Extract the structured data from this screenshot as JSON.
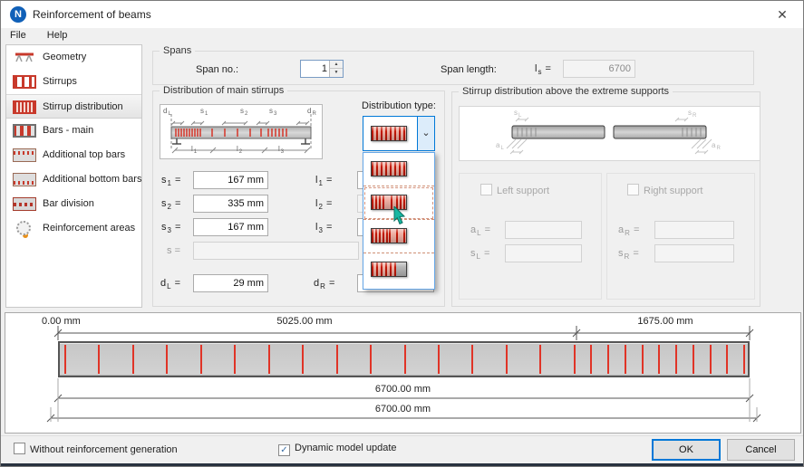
{
  "window": {
    "title": "Reinforcement of beams",
    "close_glyph": "✕",
    "app_icon_letter": "N"
  },
  "menu": {
    "items": [
      {
        "label": "File"
      },
      {
        "label": "Help"
      }
    ]
  },
  "sidebar": {
    "selected_index": 2,
    "items": [
      {
        "label": "Geometry",
        "icon": "geometry-icon"
      },
      {
        "label": "Stirrups",
        "icon": "stirrups-icon"
      },
      {
        "label": "Stirrup distribution",
        "icon": "stirrup-distribution-icon"
      },
      {
        "label": "Bars - main",
        "icon": "bars-main-icon"
      },
      {
        "label": "Additional top bars",
        "icon": "additional-top-bars-icon"
      },
      {
        "label": "Additional bottom bars",
        "icon": "additional-bottom-bars-icon"
      },
      {
        "label": "Bar division",
        "icon": "bar-division-icon"
      },
      {
        "label": "Reinforcement areas",
        "icon": "reinforcement-areas-icon"
      }
    ]
  },
  "spans": {
    "group_label": "Spans",
    "span_no_label": "Span no.:",
    "span_no_value": "1",
    "span_length_label": "Span length:",
    "length_symbol": {
      "sym": "l",
      "sub": "s",
      "eq": "="
    },
    "span_length_value": "6700"
  },
  "main_stirrups": {
    "group_label": "Distribution of main stirrups",
    "diagram_top_labels": [
      {
        "sym": "d",
        "sub": "L"
      },
      {
        "sym": "s",
        "sub": "1"
      },
      {
        "sym": "s",
        "sub": "2"
      },
      {
        "sym": "s",
        "sub": "3"
      },
      {
        "sym": "d",
        "sub": "R"
      }
    ],
    "diagram_bottom_labels": [
      {
        "sym": "l",
        "sub": "1"
      },
      {
        "sym": "l",
        "sub": "2"
      },
      {
        "sym": "l",
        "sub": "3"
      }
    ],
    "s_rows": [
      {
        "sym": "s",
        "sub": "1",
        "eq": "=",
        "value": "167 mm"
      },
      {
        "sym": "s",
        "sub": "2",
        "eq": "=",
        "value": "335 mm"
      },
      {
        "sym": "s",
        "sub": "3",
        "eq": "=",
        "value": "167 mm"
      },
      {
        "sym": "s",
        "sub": "",
        "eq": "=",
        "value": ""
      }
    ],
    "l_rows": [
      {
        "sym": "l",
        "sub": "1",
        "eq": "=",
        "value": ""
      },
      {
        "sym": "l",
        "sub": "2",
        "eq": "=",
        "value": ""
      },
      {
        "sym": "l",
        "sub": "3",
        "eq": "=",
        "value": ""
      }
    ],
    "d_left": {
      "sym": "d",
      "sub": "L",
      "eq": "=",
      "value": "29 mm"
    },
    "d_right": {
      "sym": "d",
      "sub": "R",
      "eq": "=",
      "value": ""
    }
  },
  "distribution_type": {
    "label": "Distribution type:",
    "selected_option_icon": "stirrup-pattern-uniform-icon",
    "options": [
      {
        "icon": "stirrup-pattern-uniform-icon"
      },
      {
        "icon": "stirrup-pattern-symmetric-icon"
      },
      {
        "icon": "stirrup-pattern-left-dense-icon"
      },
      {
        "icon": "stirrup-pattern-partial-icon"
      }
    ]
  },
  "supports": {
    "group_label": "Stirrup distribution above the extreme supports",
    "diagram_labels": [
      {
        "sym": "s",
        "sub": "L"
      },
      {
        "sym": "a",
        "sub": "L"
      },
      {
        "sym": "s",
        "sub": "R"
      },
      {
        "sym": "a",
        "sub": "R"
      }
    ],
    "left": {
      "checkbox_label": "Left support",
      "checked": false,
      "rows": [
        {
          "sym": "a",
          "sub": "L",
          "eq": "=",
          "value": ""
        },
        {
          "sym": "s",
          "sub": "L",
          "eq": "=",
          "value": ""
        }
      ]
    },
    "right": {
      "checkbox_label": "Right support",
      "checked": false,
      "rows": [
        {
          "sym": "a",
          "sub": "R",
          "eq": "=",
          "value": ""
        },
        {
          "sym": "s",
          "sub": "R",
          "eq": "=",
          "value": ""
        }
      ]
    }
  },
  "preview": {
    "dim_labels_top": [
      "0.00 mm",
      "5025.00 mm",
      "1675.00 mm"
    ],
    "dim_total_inner": "6700.00 mm",
    "dim_total_outer": "6700.00 mm",
    "total_length_mm": 6700,
    "boundary_mm": 5025,
    "segments": [
      {
        "from_mm": 0,
        "to_mm": 5025,
        "stirrup_count": 16
      },
      {
        "from_mm": 5025,
        "to_mm": 6700,
        "stirrup_count": 11
      }
    ]
  },
  "footer": {
    "without_reinforcement_label": "Without reinforcement generation",
    "without_reinforcement_checked": false,
    "dynamic_update_label": "Dynamic model update",
    "dynamic_update_checked": true,
    "ok_label": "OK",
    "cancel_label": "Cancel"
  },
  "icons": {
    "chevron_down": "⌄",
    "check": "✓",
    "spin_up": "▲",
    "spin_down": "▼"
  },
  "colors": {
    "accent_blue": "#0078d7",
    "stirrup_red": "#e03427",
    "beam_gray": "#cdcdcd",
    "cursor_teal": "#18b7a2"
  }
}
